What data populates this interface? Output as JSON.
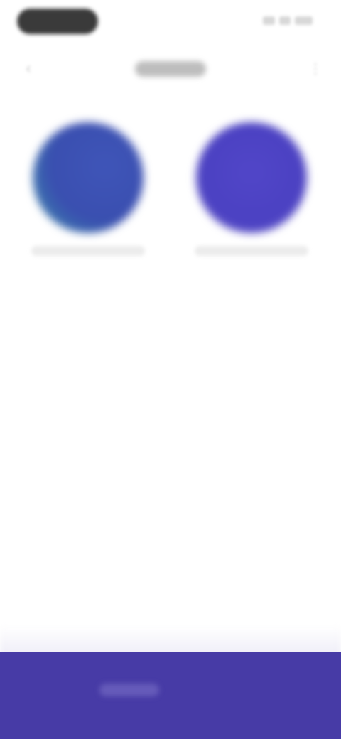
{
  "header": {
    "title": "",
    "back_icon": "back-arrow-icon",
    "menu_icon": "more-icon"
  },
  "options": [
    {
      "label": "",
      "color": "#3a4fb0",
      "accent_color": "#44b3a6"
    },
    {
      "label": "",
      "color": "#4b41c2"
    }
  ],
  "bottom_bar": {
    "button_label": "",
    "background": "#473ba6"
  }
}
